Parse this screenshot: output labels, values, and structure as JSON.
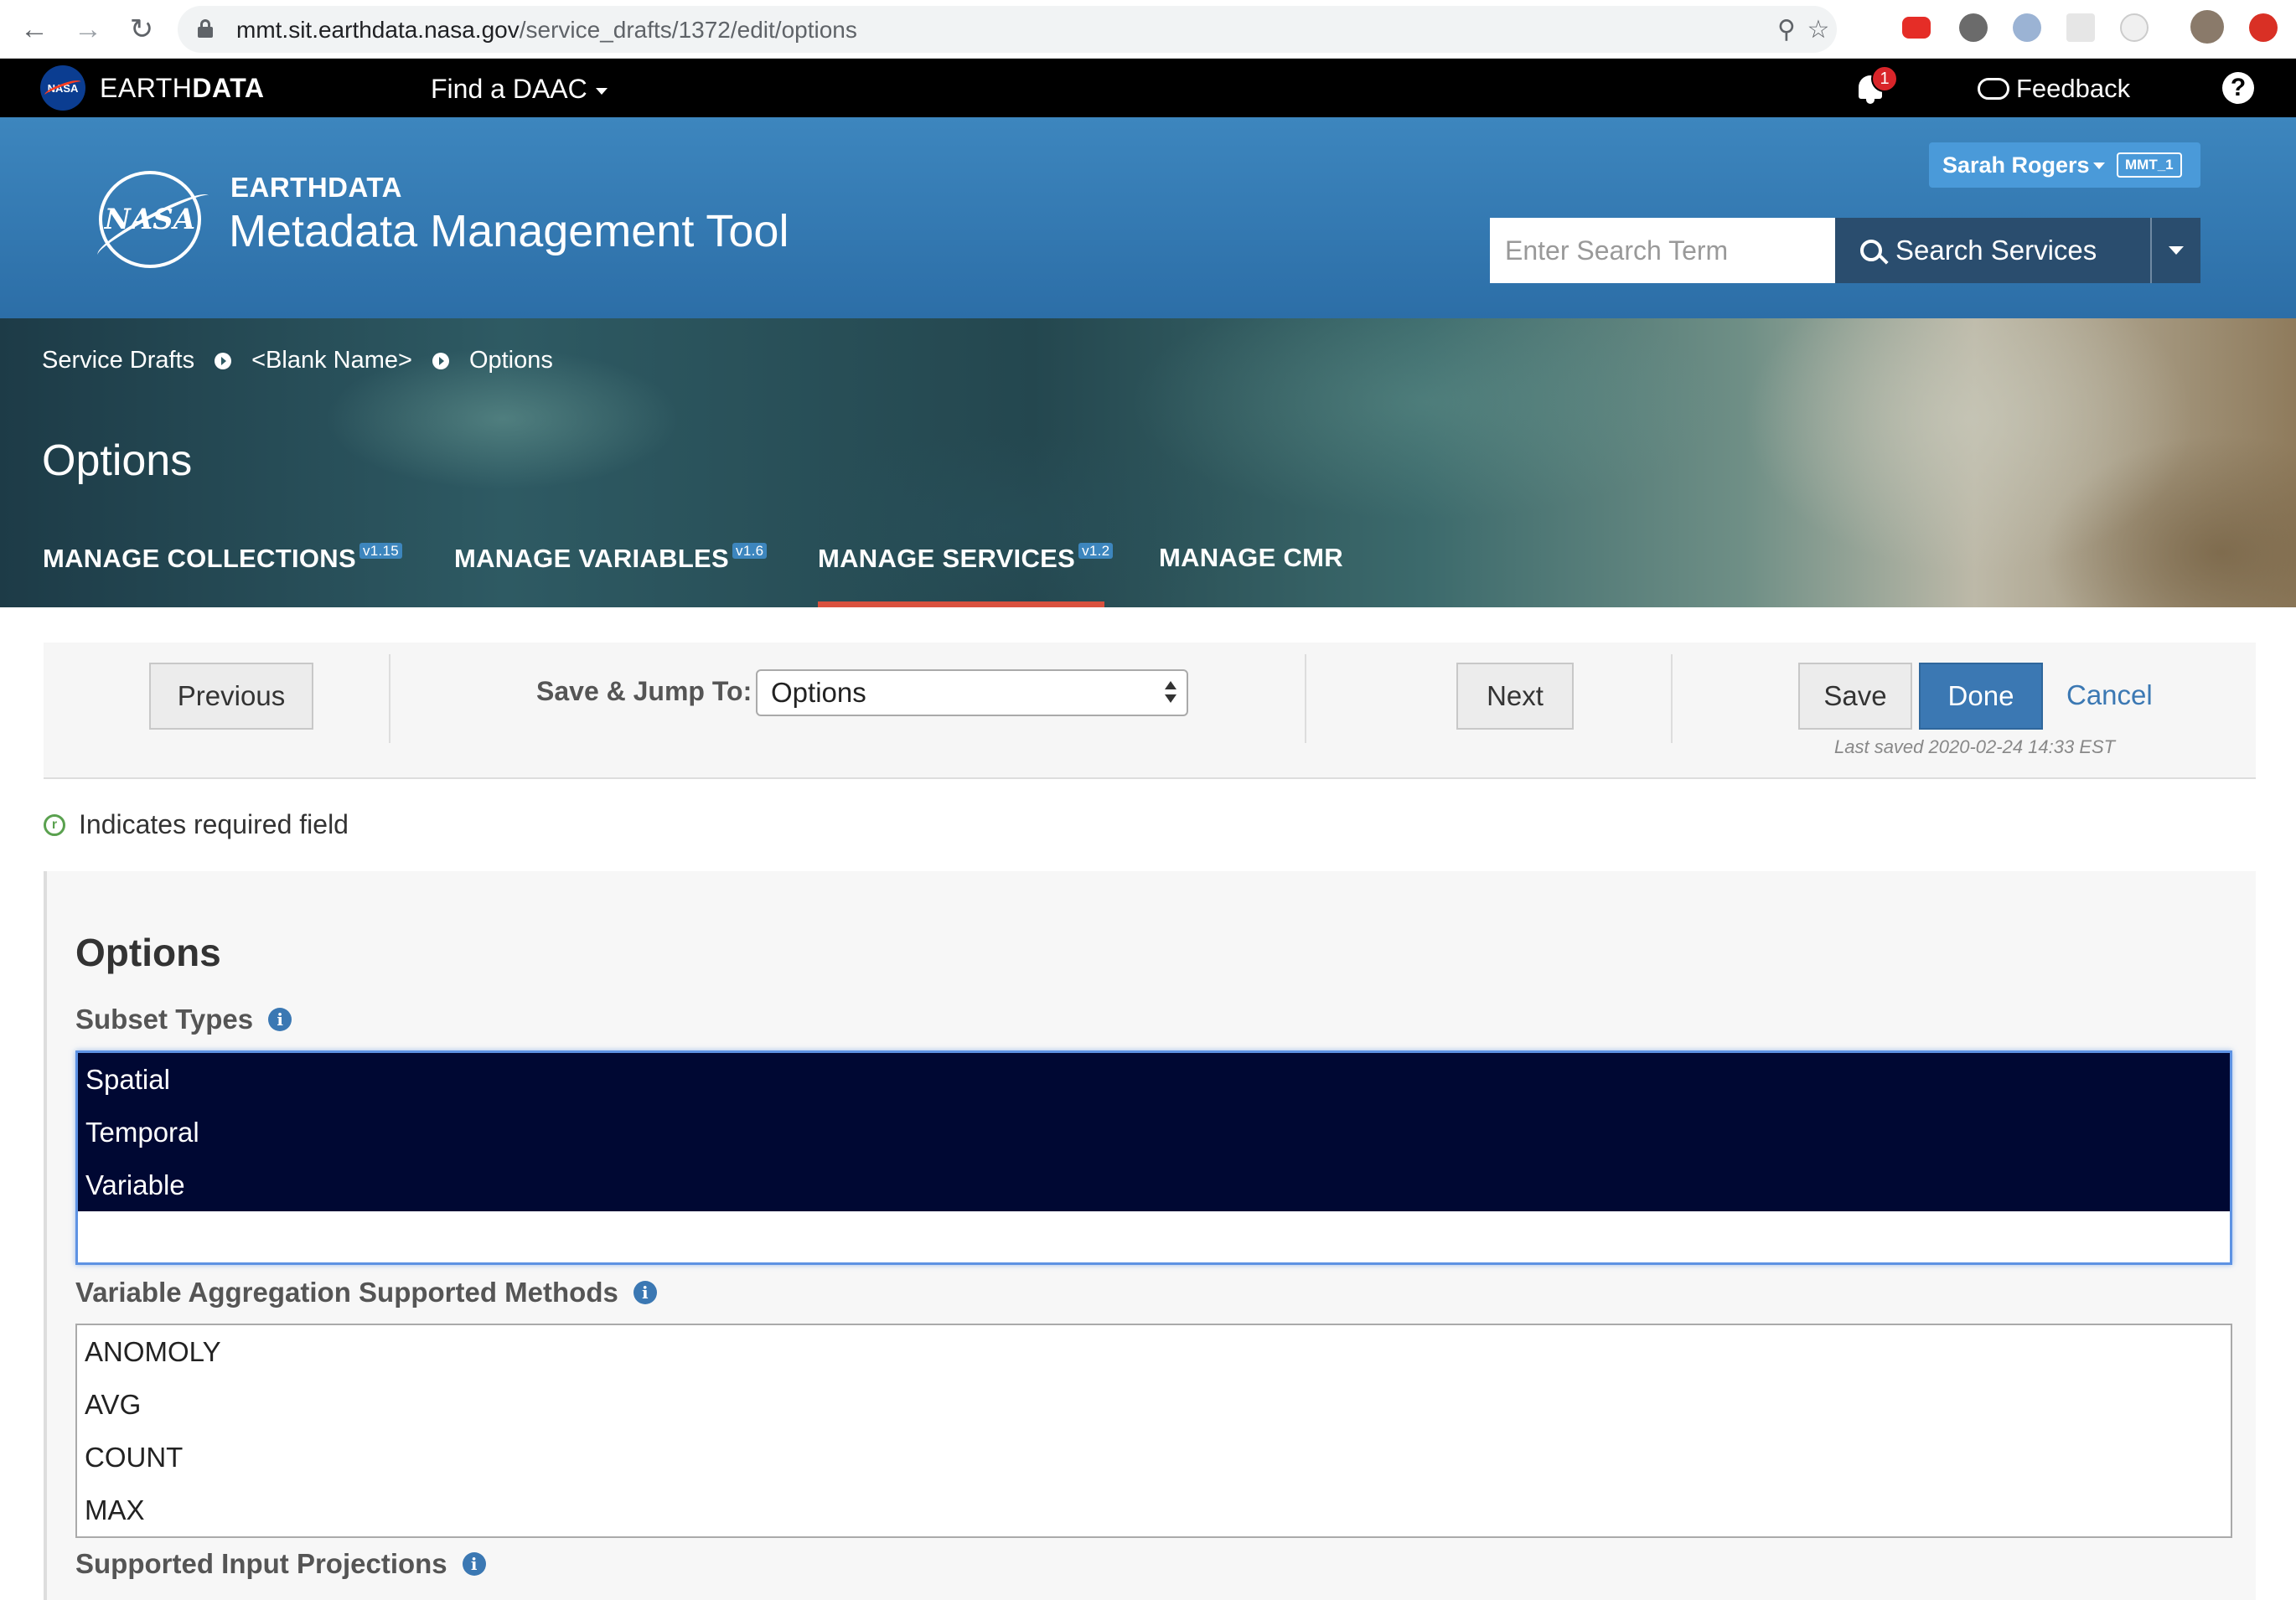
{
  "browser": {
    "url_host": "mmt.sit.earthdata.nasa.gov",
    "url_path": "/service_drafts/1372/edit/options"
  },
  "topbar": {
    "brand_light": "EARTH",
    "brand_bold": "DATA",
    "find_daac": "Find a DAAC",
    "notification_count": "1",
    "feedback": "Feedback",
    "help": "?"
  },
  "header": {
    "logo_text": "NASA",
    "small_title": "EARTHDATA",
    "big_title": "Metadata Management Tool",
    "user_name": "Sarah Rogers",
    "provider": "MMT_1",
    "search_placeholder": "Enter Search Term",
    "search_button": "Search Services"
  },
  "breadcrumb": [
    "Service Drafts",
    "<Blank Name>",
    "Options"
  ],
  "page_title": "Options",
  "tabs": [
    {
      "label": "MANAGE COLLECTIONS",
      "version": "v1.15",
      "active": false
    },
    {
      "label": "MANAGE VARIABLES",
      "version": "v1.6",
      "active": false
    },
    {
      "label": "MANAGE SERVICES",
      "version": "v1.2",
      "active": true
    },
    {
      "label": "MANAGE CMR",
      "version": "",
      "active": false
    }
  ],
  "form_nav": {
    "previous": "Previous",
    "jump_label": "Save & Jump To:",
    "jump_value": "Options",
    "next": "Next",
    "save": "Save",
    "done": "Done",
    "cancel": "Cancel",
    "last_saved": "Last saved 2020-02-24 14:33 EST"
  },
  "required_note": {
    "icon": "r",
    "text": "Indicates required field"
  },
  "panel": {
    "title": "Options",
    "subset_label": "Subset Types",
    "subset_options": [
      {
        "label": "Spatial",
        "selected": true
      },
      {
        "label": "Temporal",
        "selected": true
      },
      {
        "label": "Variable",
        "selected": true
      }
    ],
    "agg_label": "Variable Aggregation Supported Methods",
    "agg_options": [
      {
        "label": "ANOMOLY",
        "selected": false
      },
      {
        "label": "AVG",
        "selected": false
      },
      {
        "label": "COUNT",
        "selected": false
      },
      {
        "label": "MAX",
        "selected": false
      }
    ],
    "projections_label": "Supported Input Projections",
    "info_glyph": "i"
  },
  "colors": {
    "header_blue": "#3d86be",
    "selected_option": "#000833",
    "primary_button": "#3b78b3",
    "active_tab_underline": "#d9513e"
  }
}
